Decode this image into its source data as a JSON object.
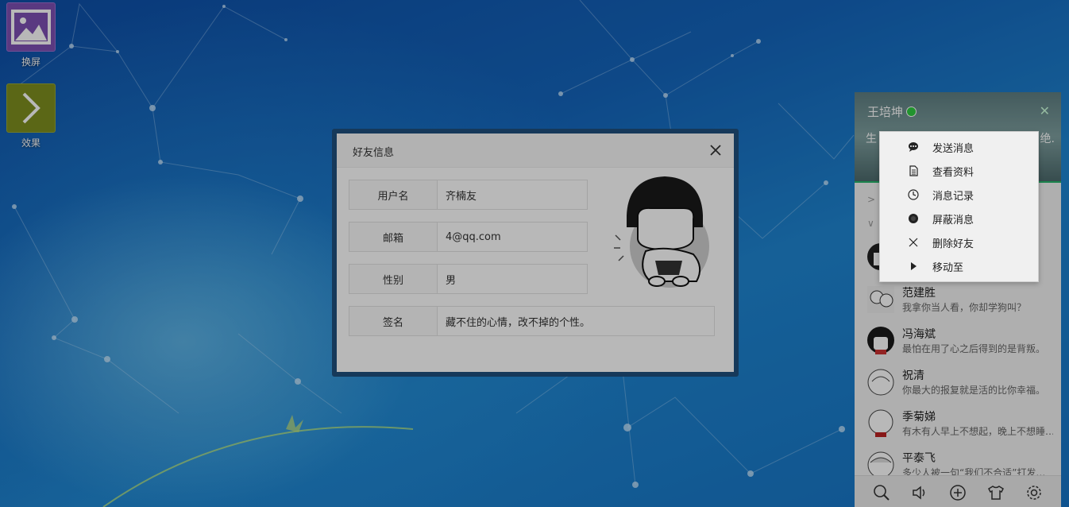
{
  "desktop": {
    "icons": [
      {
        "label": "换屏",
        "icon": "image-icon"
      },
      {
        "label": "效果",
        "icon": "chevron-right-icon"
      }
    ]
  },
  "dialog": {
    "title": "好友信息",
    "fields": [
      {
        "label": "用户名",
        "value": "齐楠友"
      },
      {
        "label": "邮箱",
        "value": "4@qq.com"
      },
      {
        "label": "性别",
        "value": "男"
      },
      {
        "label": "签名",
        "value": "藏不住的心情，改不掉的个性。"
      }
    ]
  },
  "chat": {
    "username": "王培坤",
    "signature_start": "生",
    "signature_end": "绝.",
    "friends": [
      {
        "name": "范建胜",
        "signature": "我拿你当人看，你却学狗叫？"
      },
      {
        "name": "冯海斌",
        "signature": "最怕在用了心之后得到的是背叛。"
      },
      {
        "name": "祝清",
        "signature": "你最大的报复就是活的比你幸福。"
      },
      {
        "name": "季菊娣",
        "signature": "有木有人早上不想起，晚上不想睡…"
      },
      {
        "name": "平泰飞",
        "signature": "多少人被一句“我们不合适”打发…"
      }
    ],
    "toolbar": [
      "search-icon",
      "volume-icon",
      "add-icon",
      "skin-icon",
      "settings-icon"
    ]
  },
  "context_menu": {
    "items": [
      {
        "label": "发送消息",
        "icon": "chat-icon"
      },
      {
        "label": "查看资料",
        "icon": "document-icon"
      },
      {
        "label": "消息记录",
        "icon": "clock-icon"
      },
      {
        "label": "屏蔽消息",
        "icon": "block-icon"
      },
      {
        "label": "删除好友",
        "icon": "close-icon"
      },
      {
        "label": "移动至",
        "icon": "play-icon"
      }
    ]
  },
  "colors": {
    "dialog_frame": "#1f4f7d",
    "online": "#2ecc40",
    "accent_line": "#25b66a"
  }
}
